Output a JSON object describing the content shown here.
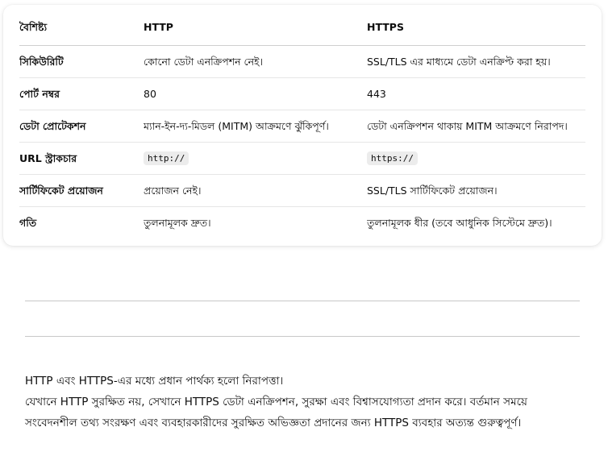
{
  "table": {
    "headers": [
      "বৈশিষ্ট্য",
      "HTTP",
      "HTTPS"
    ],
    "rows": [
      {
        "feature": "সিকিউরিটি",
        "http": "কোনো ডেটা এনক্রিপশন নেই।",
        "https": "SSL/TLS এর মাধ্যমে ডেটা এনক্রিপ্ট করা হয়।"
      },
      {
        "feature": "পোর্ট নম্বর",
        "http": "80",
        "https": "443"
      },
      {
        "feature": "ডেটা প্রোটেকশন",
        "http": "ম্যান-ইন-দ্য-মিডল (MITM) আক্রমণে ঝুঁকিপূর্ণ।",
        "https": "ডেটা এনক্রিপশন থাকায় MITM আক্রমণে নিরাপদ।"
      },
      {
        "feature": "URL স্ট্রাকচার",
        "http": "http://",
        "https": "https://"
      },
      {
        "feature": "সার্টিফিকেট প্রয়োজন",
        "http": "প্রয়োজন নেই।",
        "https": "SSL/TLS সার্টিফিকেট প্রয়োজন।"
      },
      {
        "feature": "গতি",
        "http": "তুলনামূলক দ্রুত।",
        "https": "তুলনামূলক ধীর (তবে আধুনিক সিস্টেমে দ্রুত)।"
      }
    ]
  },
  "summary": {
    "line1": "HTTP এবং HTTPS-এর মধ্যে প্রধান পার্থক্য হলো নিরাপত্তা।",
    "line2": "যেখানে HTTP সুরক্ষিত নয়, সেখানে HTTPS ডেটা এনক্রিপশন, সুরক্ষা এবং বিশ্বাসযোগ্যতা প্রদান করে। বর্তমান সময়ে সংবেদনশীল তথ্য সংরক্ষণ এবং ব্যবহারকারীদের সুরক্ষিত অভিজ্ঞতা প্রদানের জন্য HTTPS ব্যবহার অত্যন্ত গুরুত্বপূর্ণ।"
  }
}
